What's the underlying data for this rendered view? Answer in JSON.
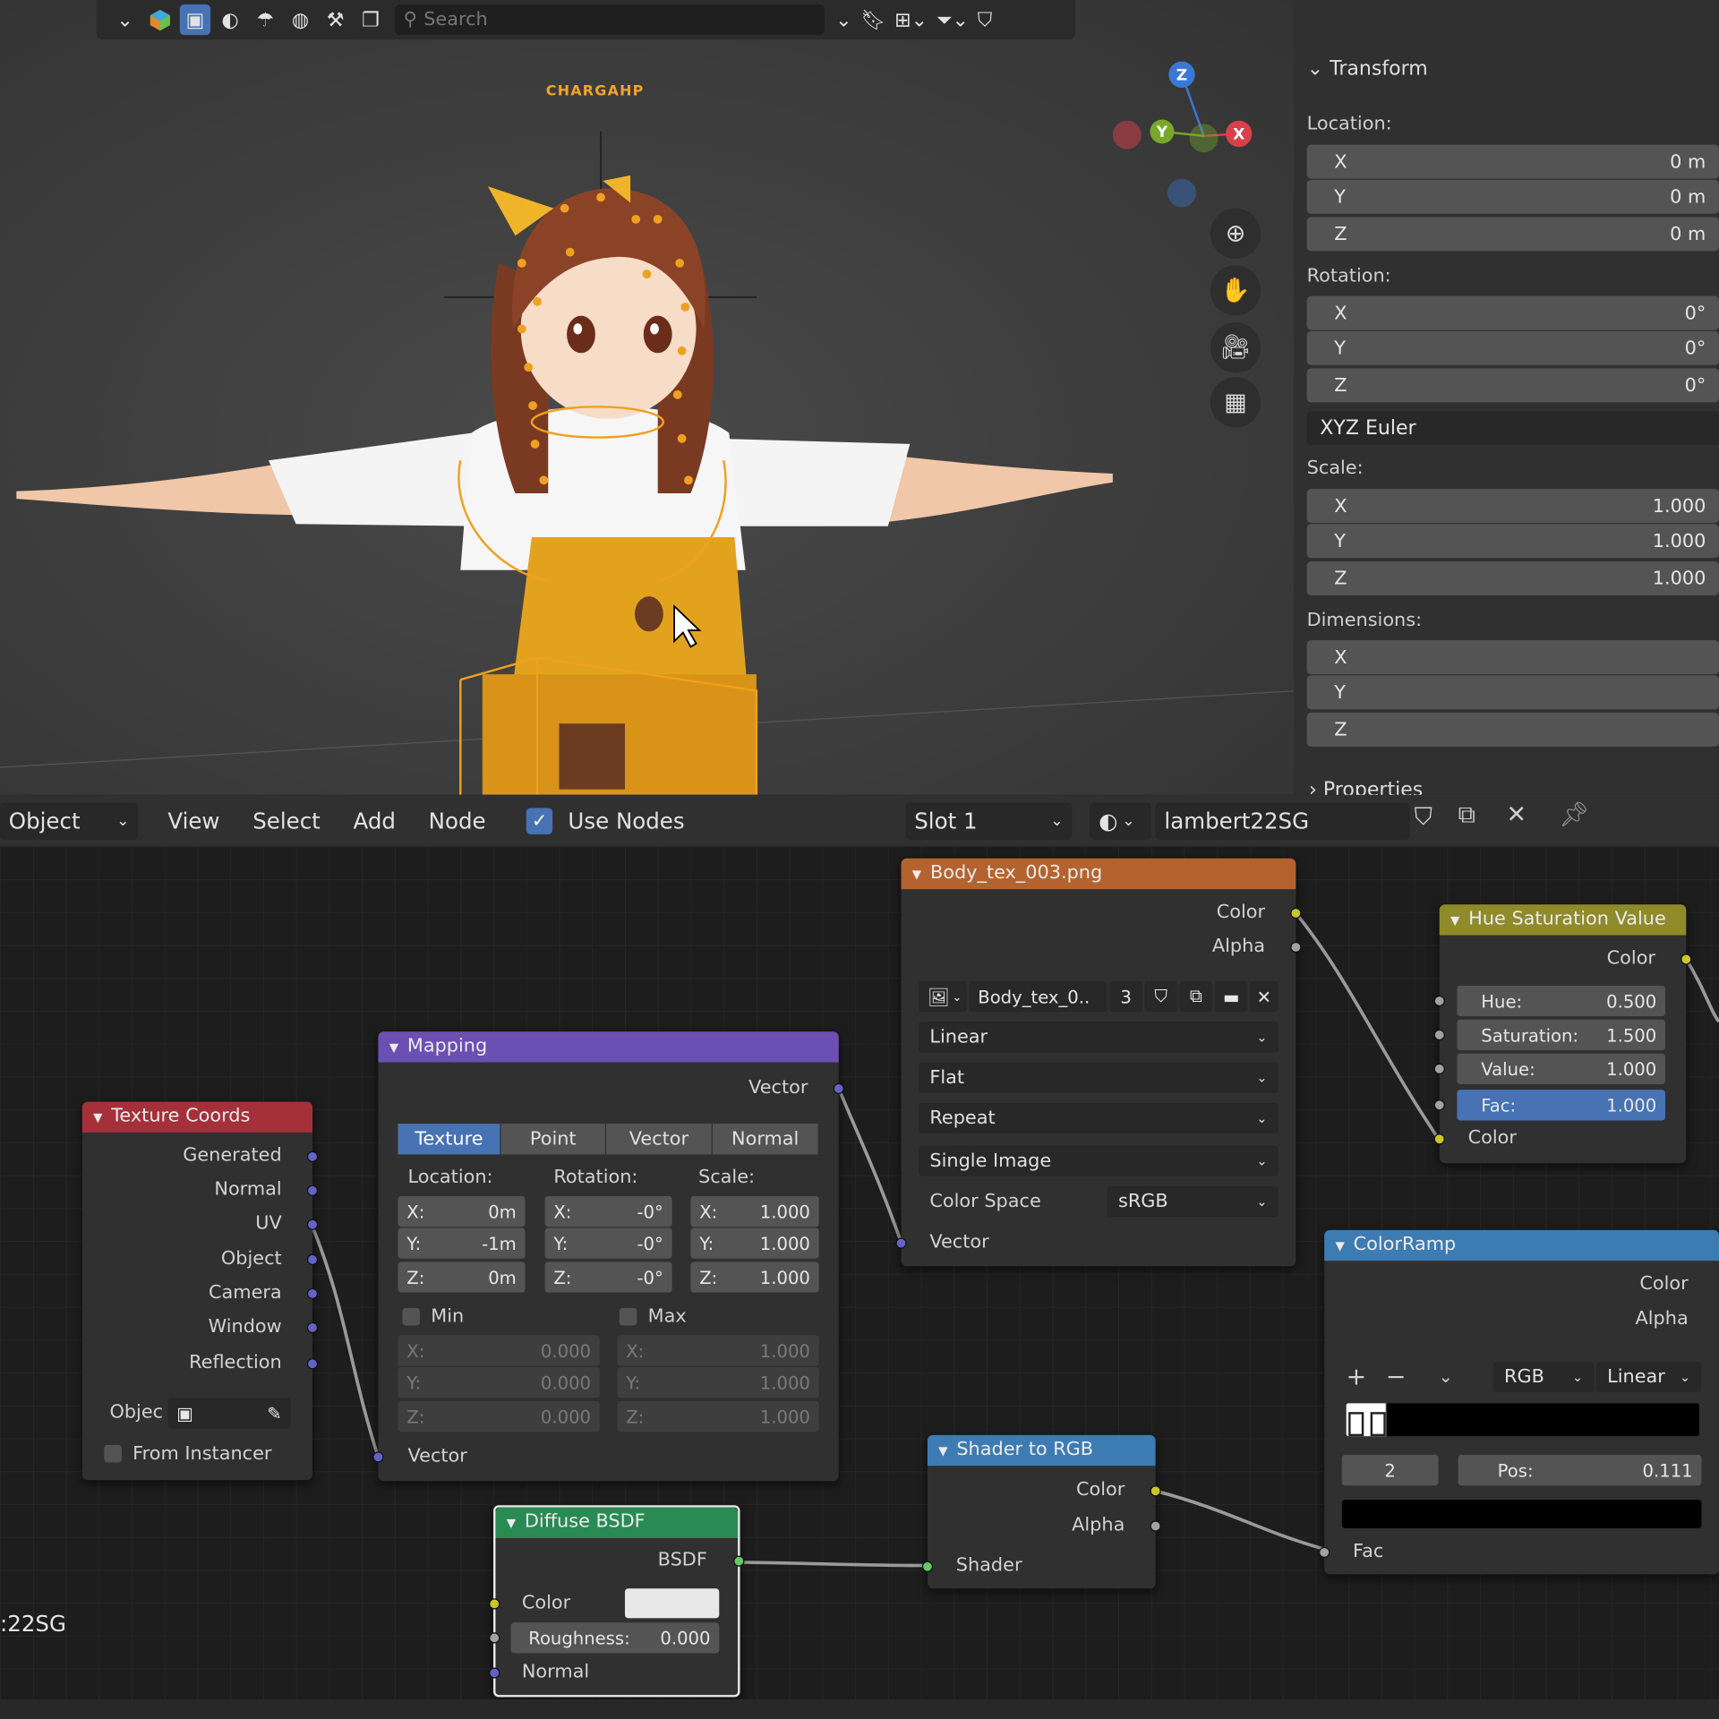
{
  "viewport": {
    "search_placeholder": "Search",
    "character_label": "CHARGAHP",
    "gizmo": {
      "z": "Z",
      "y": "Y",
      "x": "X"
    },
    "nav_icons": [
      "zoom-icon",
      "pan-hand-icon",
      "camera-icon",
      "grid-icon"
    ]
  },
  "properties": {
    "transform_title": "Transform",
    "location_label": "Location:",
    "location": [
      {
        "axis": "X",
        "value": "0 m"
      },
      {
        "axis": "Y",
        "value": "0 m"
      },
      {
        "axis": "Z",
        "value": "0 m"
      }
    ],
    "rotation_label": "Rotation:",
    "rotation": [
      {
        "axis": "X",
        "value": "0°"
      },
      {
        "axis": "Y",
        "value": "0°"
      },
      {
        "axis": "Z",
        "value": "0°"
      }
    ],
    "rotation_mode": "XYZ Euler",
    "scale_label": "Scale:",
    "scale": [
      {
        "axis": "X",
        "value": "1.000"
      },
      {
        "axis": "Y",
        "value": "1.000"
      },
      {
        "axis": "Z",
        "value": "1.000"
      }
    ],
    "dimensions_label": "Dimensions:",
    "dimensions": [
      {
        "axis": "X",
        "value": ""
      },
      {
        "axis": "Y",
        "value": ""
      },
      {
        "axis": "Z",
        "value": ""
      }
    ],
    "properties_title": "Properties"
  },
  "node_header": {
    "mode": "Object",
    "menus": [
      "View",
      "Select",
      "Add",
      "Node"
    ],
    "use_nodes_label": "Use Nodes",
    "slot": "Slot 1",
    "material_name": "lambert22SG",
    "side_label": ":22SG"
  },
  "nodes": {
    "texture_coords": {
      "title": "Texture Coords",
      "outputs": [
        "Generated",
        "Normal",
        "UV",
        "Object",
        "Camera",
        "Window",
        "Reflection"
      ],
      "object_label": "Objec",
      "from_instancer": "From Instancer"
    },
    "mapping": {
      "title": "Mapping",
      "output": "Vector",
      "tabs": [
        "Texture",
        "Point",
        "Vector",
        "Normal"
      ],
      "location_label": "Location:",
      "rotation_label": "Rotation:",
      "scale_label": "Scale:",
      "location": [
        {
          "axis": "X:",
          "value": "0m"
        },
        {
          "axis": "Y:",
          "value": "-1m"
        },
        {
          "axis": "Z:",
          "value": "0m"
        }
      ],
      "rotation": [
        {
          "axis": "X:",
          "value": "-0°"
        },
        {
          "axis": "Y:",
          "value": "-0°"
        },
        {
          "axis": "Z:",
          "value": "-0°"
        }
      ],
      "scale": [
        {
          "axis": "X:",
          "value": "1.000"
        },
        {
          "axis": "Y:",
          "value": "1.000"
        },
        {
          "axis": "Z:",
          "value": "1.000"
        }
      ],
      "min_label": "Min",
      "max_label": "Max",
      "min": [
        {
          "axis": "X:",
          "value": "0.000"
        },
        {
          "axis": "Y:",
          "value": "0.000"
        },
        {
          "axis": "Z:",
          "value": "0.000"
        }
      ],
      "max": [
        {
          "axis": "X:",
          "value": "1.000"
        },
        {
          "axis": "Y:",
          "value": "1.000"
        },
        {
          "axis": "Z:",
          "value": "1.000"
        }
      ],
      "input": "Vector"
    },
    "image_texture": {
      "title": "Body_tex_003.png",
      "outputs": [
        "Color",
        "Alpha"
      ],
      "image_name": "Body_tex_0..",
      "users": "3",
      "interpolation": "Linear",
      "projection": "Flat",
      "extension": "Repeat",
      "source": "Single Image",
      "color_space_label": "Color Space",
      "color_space": "sRGB",
      "input": "Vector"
    },
    "hsv": {
      "title": "Hue Saturation Value",
      "output": "Color",
      "fields": [
        {
          "label": "Hue:",
          "value": "0.500"
        },
        {
          "label": "Saturation:",
          "value": "1.500"
        },
        {
          "label": "Value:",
          "value": "1.000"
        },
        {
          "label": "Fac:",
          "value": "1.000"
        }
      ],
      "color_input": "Color"
    },
    "colorramp": {
      "title": "ColorRamp",
      "outputs": [
        "Color",
        "Alpha"
      ],
      "color_mode": "RGB",
      "interpolation": "Linear",
      "stop_index": "2",
      "pos_label": "Pos:",
      "pos_value": "0.111",
      "input": "Fac"
    },
    "shader_to_rgb": {
      "title": "Shader to RGB",
      "outputs": [
        "Color",
        "Alpha"
      ],
      "input": "Shader"
    },
    "diffuse": {
      "title": "Diffuse BSDF",
      "output": "BSDF",
      "color_label": "Color",
      "roughness_label": "Roughness:",
      "roughness_value": "0.000",
      "normal_label": "Normal"
    }
  },
  "colors": {
    "accent_blue": "#4772b3",
    "header_red": "#a5303a",
    "header_purple": "#6b4fb3",
    "header_orange": "#b5632e",
    "header_yellow": "#8f8a2a",
    "header_blue": "#3d7bb3",
    "header_green": "#2a8a54"
  }
}
